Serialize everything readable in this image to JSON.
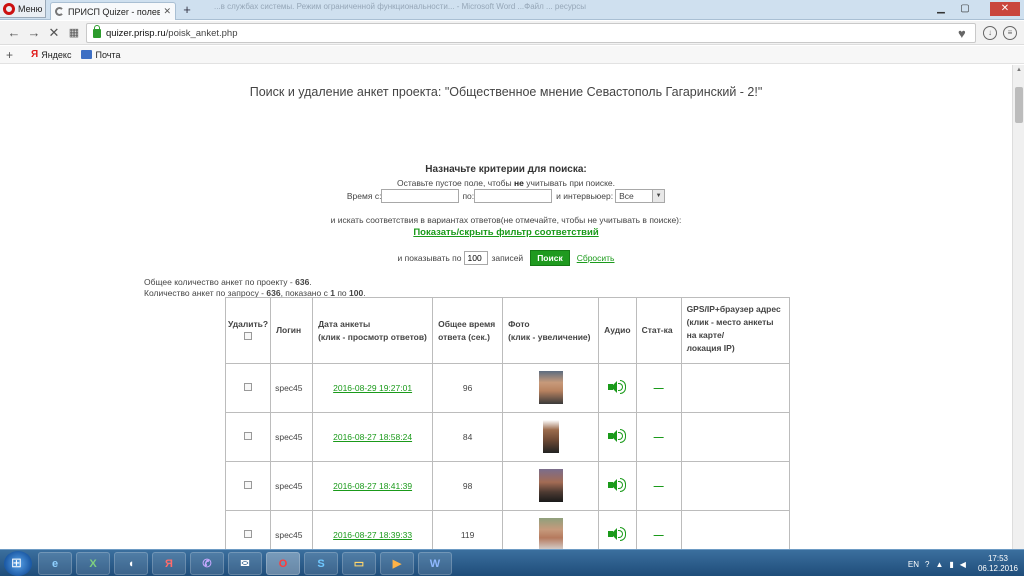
{
  "window": {
    "menu_label": "Меню",
    "tab_title": "ПРИСП Quizer - полевая",
    "background_title": "...в службах системы. Режим ограниченной функциональности... - Microsoft Word        ...Файл ... ресурсы"
  },
  "addressbar": {
    "url_host": "quizer.prisp.ru",
    "url_path": "/poisk_anket.php"
  },
  "bookmarks": [
    {
      "label": "Яндекс"
    },
    {
      "label": "Почта"
    }
  ],
  "page": {
    "title": "Поиск и удаление анкет проекта: \"Общественное мнение Севастополь Гагаринский - 2!\"",
    "criteria_title": "Назначьте критерии для поиска:",
    "hint_prefix": "Оставьте пустое поле, чтобы",
    "hint_bold": "не",
    "hint_suffix": "учитывать при поиске.",
    "time_from_label": "Время с:",
    "time_to_label": "по:",
    "interviewer_label": "и интервьюер:",
    "interviewer_value": "Все",
    "match_text": "и искать соответствия в вариантах ответов(не отмечайте, чтобы не учитывать в поиске):",
    "toggle_filter_link": "Показать/скрыть фильтр соответствий",
    "show_label": "и показывать по",
    "show_count": "100",
    "records_label": "записей",
    "search_button": "Поиск",
    "reset_link": "Сбросить",
    "total_project_prefix": "Общее количество анкет по проекту -",
    "total_project_count": "636",
    "total_query_prefix": "Количество анкет по запросу -",
    "total_query_count": "636",
    "shown_prefix": ", показано с",
    "shown_from": "1",
    "shown_to_prefix": "по",
    "shown_to": "100"
  },
  "table": {
    "headers": {
      "delete": "Удалить?",
      "login": "Логин",
      "date_line1": "Дата анкеты",
      "date_line2": "(клик - просмотр ответов)",
      "time_line1": "Общее время",
      "time_line2": "ответа (сек.)",
      "photo_line1": "Фото",
      "photo_line2": "(клик - увеличение)",
      "audio": "Аудио",
      "stat": "Стат-ка",
      "gps_line1": "GPS/IP+браузер адрес",
      "gps_line2": "(клик - место анкеты",
      "gps_line3": "на карте/",
      "gps_line4": "локация IP)"
    },
    "rows": [
      {
        "login": "spec45",
        "date": "2016-08-29 19:27:01",
        "time": "96",
        "stat": "—"
      },
      {
        "login": "spec45",
        "date": "2016-08-27 18:58:24",
        "time": "84",
        "stat": "—"
      },
      {
        "login": "spec45",
        "date": "2016-08-27 18:41:39",
        "time": "98",
        "stat": "—"
      },
      {
        "login": "spec45",
        "date": "2016-08-27 18:39:33",
        "time": "119",
        "stat": "—"
      }
    ]
  },
  "taskbar": {
    "lang": "EN",
    "time": "17:53",
    "date": "06.12.2016"
  }
}
